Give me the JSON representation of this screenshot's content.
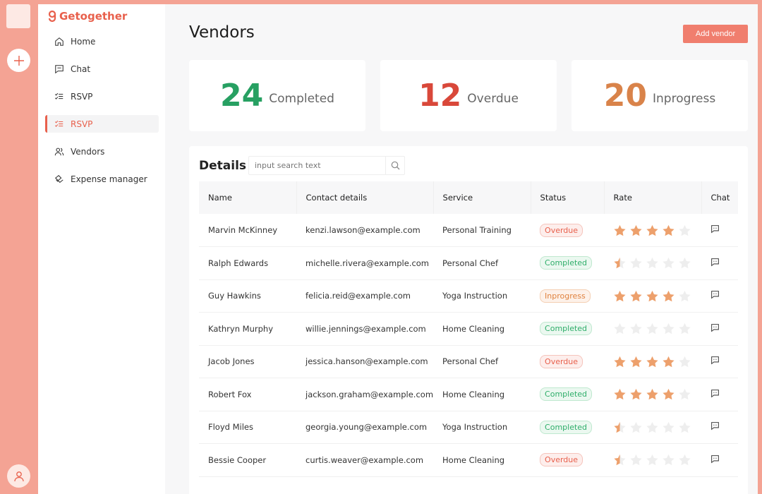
{
  "app": {
    "name": "Getogether"
  },
  "nav": [
    {
      "label": "Home",
      "icon": "home-icon",
      "active": false
    },
    {
      "label": "Chat",
      "icon": "chat-icon",
      "active": false
    },
    {
      "label": "RSVP",
      "icon": "checklist-icon",
      "active": false
    },
    {
      "label": "RSVP",
      "icon": "checklist-icon",
      "active": true
    },
    {
      "label": "Vendors",
      "icon": "users-icon",
      "active": false
    },
    {
      "label": "Expense manager",
      "icon": "expense-icon",
      "active": false
    }
  ],
  "page": {
    "title": "Vendors",
    "add_button": "Add vendor"
  },
  "stats": [
    {
      "value": "24",
      "label": "Completed",
      "color": "#27a062"
    },
    {
      "value": "12",
      "label": "Overdue",
      "color": "#d9483a"
    },
    {
      "value": "20",
      "label": "Inprogress",
      "color": "#d9834a"
    }
  ],
  "details": {
    "title": "Details",
    "search_placeholder": "input search text",
    "columns": [
      "Name",
      "Contact details",
      "Service",
      "Status",
      "Rate",
      "Chat"
    ],
    "rows": [
      {
        "name": "Marvin McKinney",
        "email": "kenzi.lawson@example.com",
        "service": "Personal Training",
        "status": "Overdue",
        "rating": 4
      },
      {
        "name": "Ralph Edwards",
        "email": "michelle.rivera@example.com",
        "service": "Personal Chef",
        "status": "Completed",
        "rating": 0.5
      },
      {
        "name": "Guy Hawkins",
        "email": "felicia.reid@example.com",
        "service": "Yoga Instruction",
        "status": "Inprogress",
        "rating": 4
      },
      {
        "name": "Kathryn Murphy",
        "email": "willie.jennings@example.com",
        "service": "Home Cleaning",
        "status": "Completed",
        "rating": 0
      },
      {
        "name": "Jacob Jones",
        "email": "jessica.hanson@example.com",
        "service": "Personal Chef",
        "status": "Overdue",
        "rating": 4
      },
      {
        "name": "Robert Fox",
        "email": "jackson.graham@example.com",
        "service": "Home Cleaning",
        "status": "Completed",
        "rating": 4
      },
      {
        "name": "Floyd Miles",
        "email": "georgia.young@example.com",
        "service": "Yoga Instruction",
        "status": "Completed",
        "rating": 0.5
      },
      {
        "name": "Bessie Cooper",
        "email": "curtis.weaver@example.com",
        "service": "Home Cleaning",
        "status": "Overdue",
        "rating": 0.5
      }
    ]
  },
  "colors": {
    "accent": "#e8604c",
    "star": "#eda06c",
    "star_empty": "#eeeeee"
  }
}
